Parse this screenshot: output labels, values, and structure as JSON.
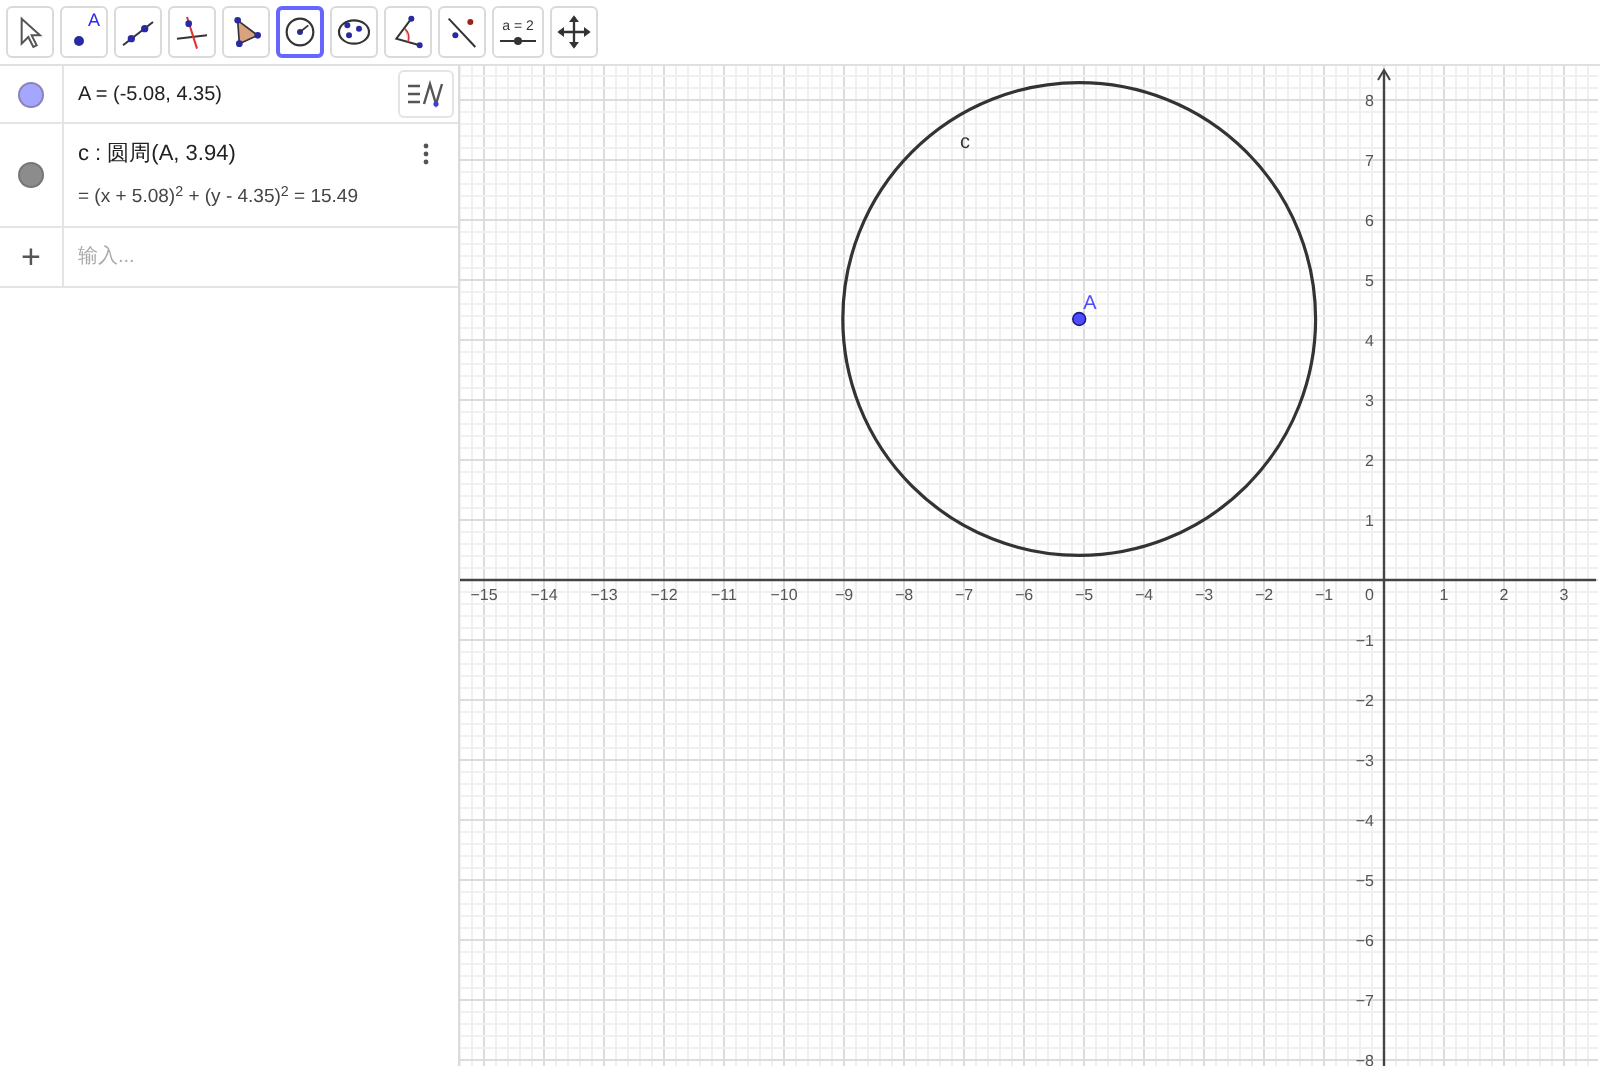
{
  "toolbar": [
    {
      "kind": "move",
      "selected": false
    },
    {
      "kind": "point",
      "selected": false,
      "label": "A"
    },
    {
      "kind": "line",
      "selected": false
    },
    {
      "kind": "perpendicular",
      "selected": false
    },
    {
      "kind": "polygon",
      "selected": false
    },
    {
      "kind": "circle",
      "selected": true
    },
    {
      "kind": "ellipse",
      "selected": false
    },
    {
      "kind": "angle",
      "selected": false
    },
    {
      "kind": "reflect",
      "selected": false
    },
    {
      "kind": "slider",
      "selected": false,
      "label": "a = 2"
    },
    {
      "kind": "move-view",
      "selected": false
    }
  ],
  "algebra": {
    "rows": [
      {
        "kind": "point",
        "color": "#a6a6ff",
        "definition": "A = (-5.08, 4.35)"
      },
      {
        "kind": "circle",
        "color": "#8c8c8c",
        "definition": "c : 圆周(A, 3.94)",
        "value": "= (x + 5.08)$^{2}$ + (y - 4.35)$^{2}$ = 15.49"
      },
      {
        "kind": "input",
        "symbol": "+",
        "placeholder": "输入..."
      }
    ]
  },
  "graphics": {
    "x_axis": {
      "negative_labels": [
        "−15",
        "−14",
        "−13",
        "−12",
        "−11",
        "−10",
        "−9",
        "−8",
        "−7",
        "−6",
        "−5",
        "−4",
        "−3",
        "−2",
        "−1"
      ],
      "origin_label": "0",
      "positive_labels": [
        "1",
        "2",
        "3"
      ]
    },
    "y_axis": {
      "positive_labels": [
        "8",
        "7",
        "6",
        "5",
        "4",
        "3",
        "2",
        "1"
      ],
      "negative_labels": [
        "−1",
        "−2",
        "−3",
        "−4",
        "−5",
        "−6",
        "−7",
        "−8"
      ]
    },
    "point_label": "A",
    "circle_label": "c"
  }
}
